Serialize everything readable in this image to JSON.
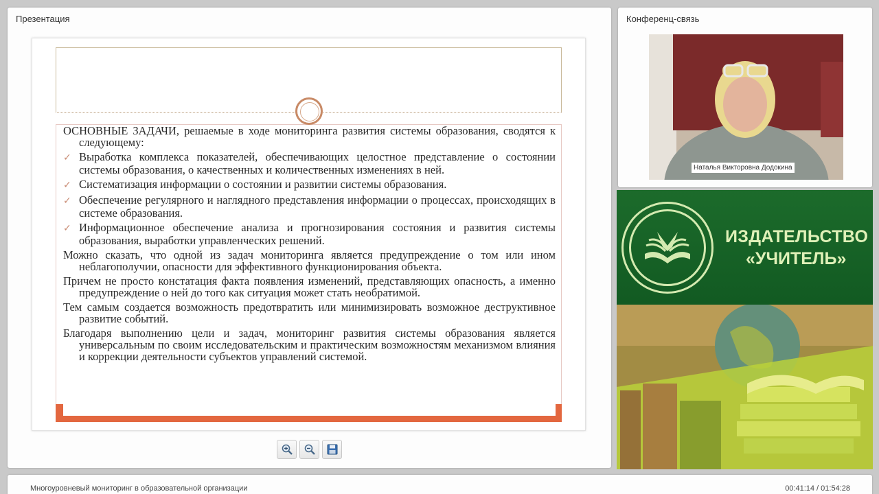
{
  "presentation": {
    "title": "Презентация",
    "slide": {
      "intro_heading": "ОСНОВНЫЕ ЗАДАЧИ",
      "intro_rest": ", решаемые в ходе мониторинга развития системы образования, сводятся к следующему:",
      "bullets": [
        "Выработка комплекса показателей, обеспечивающих целостное представление о состоянии системы образования, о качественных и количественных изменениях в ней.",
        "Систематизация информации о состоянии и развитии системы образования.",
        "Обеспечение регулярного и наглядного представления информации о процессах, происходящих в системе образования.",
        "Информационное обеспечение анализа и прогнозирования состояния и развития системы образования, выработки управленческих решений."
      ],
      "paragraphs": [
        "Можно сказать, что одной из задач мониторинга является предупреждение о том или ином неблагополучии, опасности для эффективного функционирования объекта.",
        "Причем не просто констатация факта появления изменений, представляющих опасность, а именно предупреждение о ней до того как ситуация может стать необратимой.",
        "Тем самым создается возможность предотвратить или минимизировать возможное деструктивное развитие событий.",
        "Благодаря выполнению цели и задач, мониторинг развития системы образования является универсальным по своим исследовательским и практическим возможностям механизмом влияния и коррекции деятельности субъектов управлений системой."
      ]
    },
    "toolbar": {
      "zoom_in_icon": "zoom-in-icon",
      "zoom_out_icon": "zoom-out-icon",
      "save_icon": "floppy-disk-icon"
    }
  },
  "conference": {
    "title": "Конференц-связь",
    "speaker_name": "Наталья Викторовна Додокина"
  },
  "publisher": {
    "line1": "ИЗДАТЕЛЬСТВО",
    "line2": "«УЧИТЕЛЬ»"
  },
  "footer": {
    "webinar_title": "Многоуровневый мониторинг в образовательной организации",
    "time": "00:41:14 / 01:54:28"
  },
  "colors": {
    "accent_orange": "#e3673f",
    "publisher_green": "#1c6b2b",
    "publisher_text": "#e0f1b8"
  }
}
